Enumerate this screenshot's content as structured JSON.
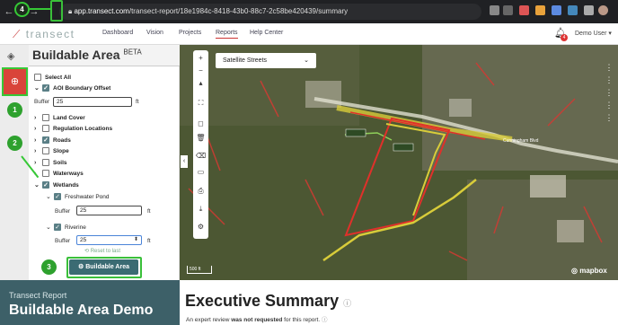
{
  "browser": {
    "url_host": "app.transect.com",
    "url_path": "/transect-report/18e1984c-8418-43b0-88c7-2c58be420439/summary"
  },
  "appbar": {
    "logo": "transect",
    "nav": [
      "Dashboard",
      "Vision",
      "Projects",
      "Reports",
      "Help Center"
    ],
    "active": "Reports",
    "notif_count": "4",
    "user": "Demo User ▾"
  },
  "panel": {
    "title": "Buildable Area",
    "title_sup": "BETA",
    "select_all": "Select All",
    "aoi": "AOI Boundary Offset",
    "buffer_label": "Buffer",
    "aoi_buffer": "25",
    "unit": "ft",
    "layers": [
      "Land Cover",
      "Regulation Locations",
      "Roads",
      "Slope",
      "Soils",
      "Waterways",
      "Wetlands"
    ],
    "sub_freshwater": "Freshwater Pond",
    "freshwater_buffer": "25",
    "sub_riverine": "Riverine",
    "riverine_buffer": "25",
    "reset": "⟲ Reset to last",
    "button": "⚙ Buildable Area"
  },
  "map": {
    "style": "Satellite Streets",
    "scale": "500 ft",
    "attribution": "◎ mapbox",
    "road_label": "Cunningham Blvd"
  },
  "report": {
    "subtitle": "Transect Report",
    "title": "Buildable Area Demo",
    "exec": "Executive Summary",
    "note_pre": "An expert review ",
    "note_bold": "was not requested",
    "note_post": " for this report."
  },
  "annotations": [
    "1",
    "2",
    "3",
    "4"
  ],
  "colors": {
    "accent": "#3b6b73",
    "highlight": "#2ea12e",
    "boundary": "#e0302a",
    "offset": "#d8cc3a"
  }
}
